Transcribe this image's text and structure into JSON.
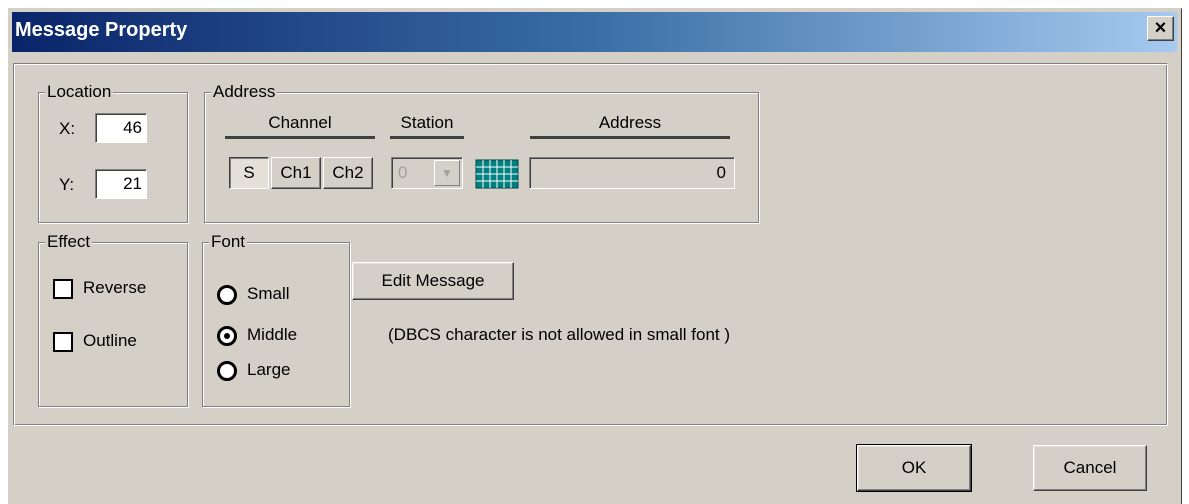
{
  "window": {
    "title": "Message Property",
    "close_glyph": "×"
  },
  "location": {
    "label": "Location",
    "x_label": "X:",
    "x_value": "46",
    "y_label": "Y:",
    "y_value": "21"
  },
  "address_group": {
    "label": "Address",
    "channel_header": "Channel",
    "station_header": "Station",
    "address_header": "Address",
    "channel_buttons": [
      "S",
      "Ch1",
      "Ch2"
    ],
    "station_value": "0",
    "address_value": "0"
  },
  "effect": {
    "label": "Effect",
    "reverse_label": "Reverse",
    "reverse_checked": false,
    "outline_label": "Outline",
    "outline_checked": false
  },
  "font": {
    "label": "Font",
    "options": [
      "Small",
      "Middle",
      "Large"
    ],
    "selected": "Middle"
  },
  "edit_message": {
    "label": "Edit Message"
  },
  "note": "(DBCS character is not allowed in small font )",
  "buttons": {
    "ok": "OK",
    "cancel": "Cancel"
  },
  "colors": {
    "face": "#d4d0c8",
    "title_start": "#0a246a",
    "title_end": "#a6caf0",
    "grid_icon": "#008080"
  }
}
